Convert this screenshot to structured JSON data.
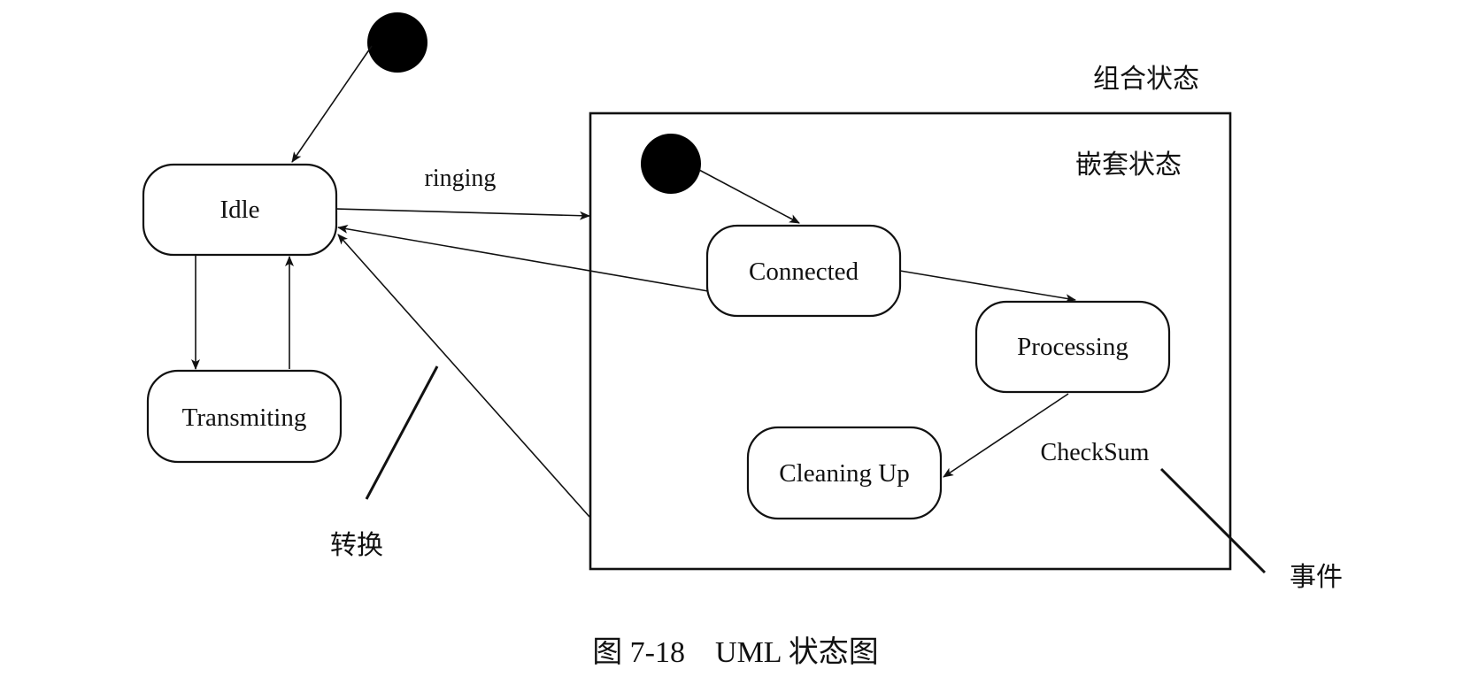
{
  "diagram": {
    "type": "uml-state-diagram",
    "states": {
      "idle": "Idle",
      "transmitting": "Transmiting",
      "connected": "Connected",
      "processing": "Processing",
      "cleaning_up": "Cleaning Up"
    },
    "edge_labels": {
      "ringing": "ringing",
      "checksum": "CheckSum"
    },
    "annotations": {
      "composite_state": "组合状态",
      "nested_state": "嵌套状态",
      "transition": "转换",
      "event": "事件"
    },
    "caption": "图 7-18　UML 状态图"
  }
}
